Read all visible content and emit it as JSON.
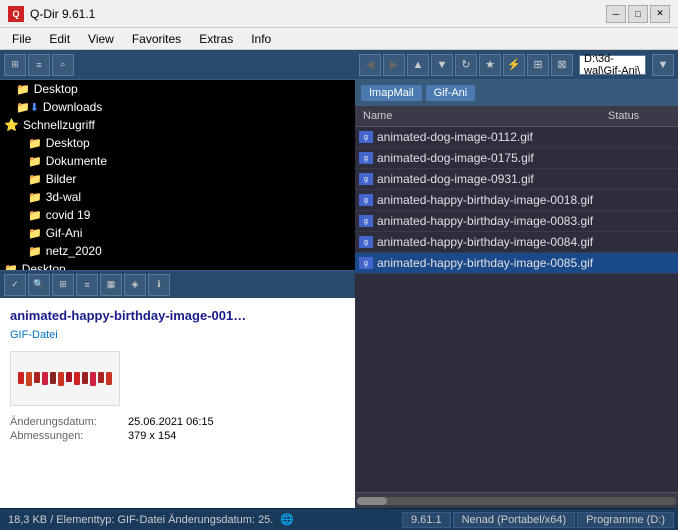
{
  "titleBar": {
    "appName": "Q-Dir 9.61.1",
    "appIconText": "Q"
  },
  "menuBar": {
    "items": [
      "File",
      "Edit",
      "View",
      "Favorites",
      "Extras",
      "Info"
    ]
  },
  "leftPanel": {
    "treeItems": [
      {
        "label": "Desktop",
        "indent": 1,
        "iconType": "folder-blue",
        "id": "desktop-top"
      },
      {
        "label": "Downloads",
        "indent": 1,
        "iconType": "folder-blue-arrow",
        "id": "downloads"
      },
      {
        "label": "Schnellzugriff",
        "indent": 0,
        "iconType": "star",
        "id": "quickaccess"
      },
      {
        "label": "Desktop",
        "indent": 2,
        "iconType": "folder-yellow",
        "id": "desktop-sub"
      },
      {
        "label": "Dokumente",
        "indent": 2,
        "iconType": "folder-yellow",
        "id": "dokumente"
      },
      {
        "label": "Bilder",
        "indent": 2,
        "iconType": "folder-yellow",
        "id": "bilder"
      },
      {
        "label": "3d-wal",
        "indent": 2,
        "iconType": "folder-yellow",
        "id": "3d-wal"
      },
      {
        "label": "covid 19",
        "indent": 2,
        "iconType": "folder-yellow",
        "id": "covid19"
      },
      {
        "label": "Gif-Ani",
        "indent": 2,
        "iconType": "folder-yellow",
        "id": "gif-ani"
      },
      {
        "label": "netz_2020",
        "indent": 2,
        "iconType": "folder-yellow",
        "id": "netz2020"
      },
      {
        "label": "Desktop",
        "indent": 0,
        "iconType": "folder-blue",
        "id": "desktop-bottom"
      }
    ]
  },
  "previewPanel": {
    "title": "animated-happy-birthday-image-001…",
    "fileType": "GIF-Datei",
    "details": {
      "changeDate": {
        "label": "Änderungsdatum:",
        "value": "25.06.2021 06:15"
      },
      "dimensions": {
        "label": "Abmessungen:",
        "value": "379 x 154"
      }
    }
  },
  "rightPanel": {
    "pathBar": "D:\\3d-wal\\Gif-Ani\\",
    "breadcrumbs": [
      "ImapMail",
      "Gif-Ani"
    ],
    "columns": {
      "name": "Name",
      "status": "Status"
    },
    "files": [
      {
        "name": "animated-dog-image-0112.gif",
        "selected": false
      },
      {
        "name": "animated-dog-image-0175.gif",
        "selected": false
      },
      {
        "name": "animated-dog-image-0931.gif",
        "selected": false
      },
      {
        "name": "animated-happy-birthday-image-0018.gif",
        "selected": false
      },
      {
        "name": "animated-happy-birthday-image-0083.gif",
        "selected": false
      },
      {
        "name": "animated-happy-birthday-image-0084.gif",
        "selected": false
      },
      {
        "name": "animated-happy-birthday-image-0085.gif",
        "selected": true
      }
    ]
  },
  "statusBar": {
    "leftText": "18,3 KB / Elementtyp: GIF-Datei Änderungsdatum: 25.",
    "rightButtons": [
      "9.61.1",
      "Nenad (Portabel/x64)",
      "Programme (D:)"
    ]
  }
}
